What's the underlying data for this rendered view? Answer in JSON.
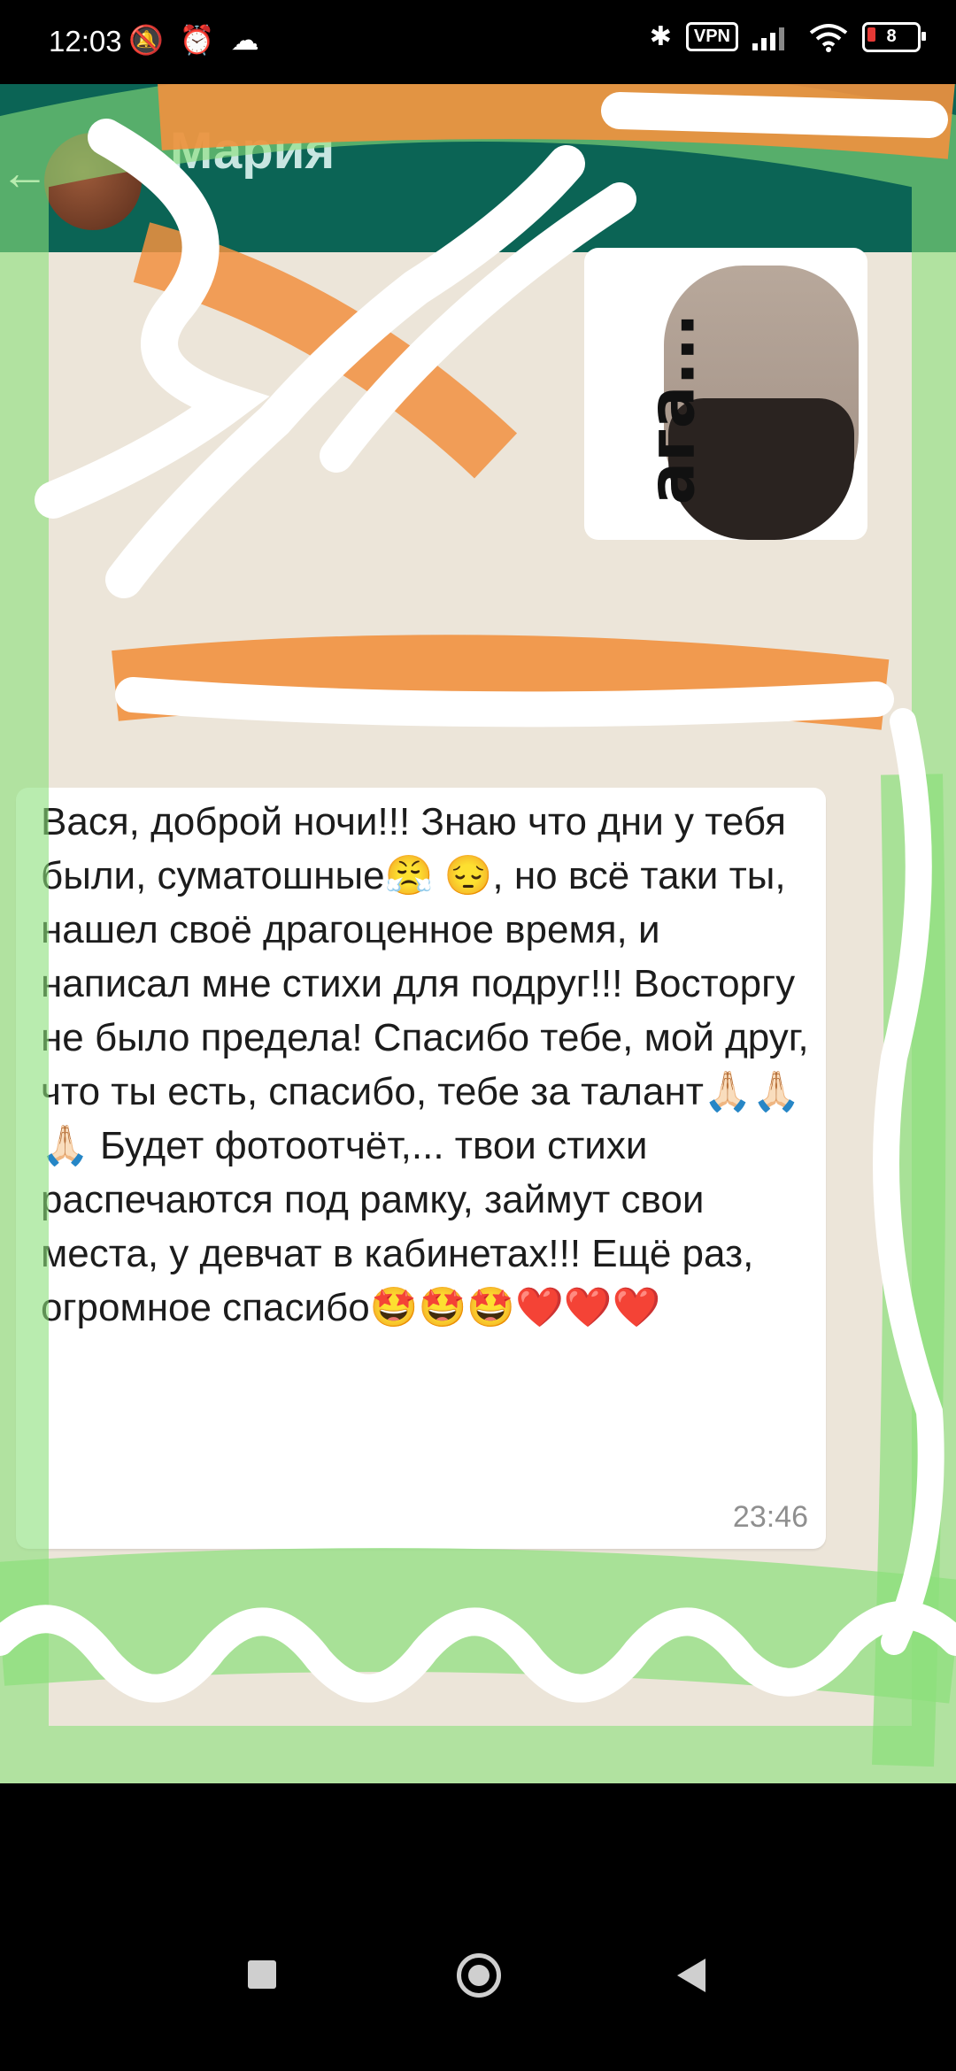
{
  "status_bar": {
    "time": "12:03",
    "vpn_label": "VPN",
    "battery_level": "8",
    "icons": [
      "mute-icon",
      "alarm-icon",
      "cloud-icon",
      "bluetooth-icon",
      "signal-icon",
      "wifi-icon",
      "battery-icon"
    ]
  },
  "chat": {
    "header": {
      "back_icon": "back-arrow-icon",
      "contact_name": "Мария"
    },
    "sticker": {
      "caption": "ага..."
    },
    "message": {
      "text": "Вася, доброй ночи!!! Знаю что дни у тебя были, суматошные😤 😔, но всё таки ты, нашел своё драгоценное время, и написал мне стихи для подруг!!! Восторгу не было предела! Спасибо тебе, мой друг, что ты есть, спасибо, тебе за талант🙏🏻🙏🏻🙏🏻 Будет фотоотчёт,... твои стихи распечаются под рамку, займут свои места, у девчат в кабинетах!!! Ещё раз, огромное спасибо🤩🤩🤩❤️❤️❤️",
      "time": "23:46"
    }
  },
  "navigation": {
    "icons": [
      "recent-apps-icon",
      "home-icon",
      "back-icon"
    ]
  }
}
